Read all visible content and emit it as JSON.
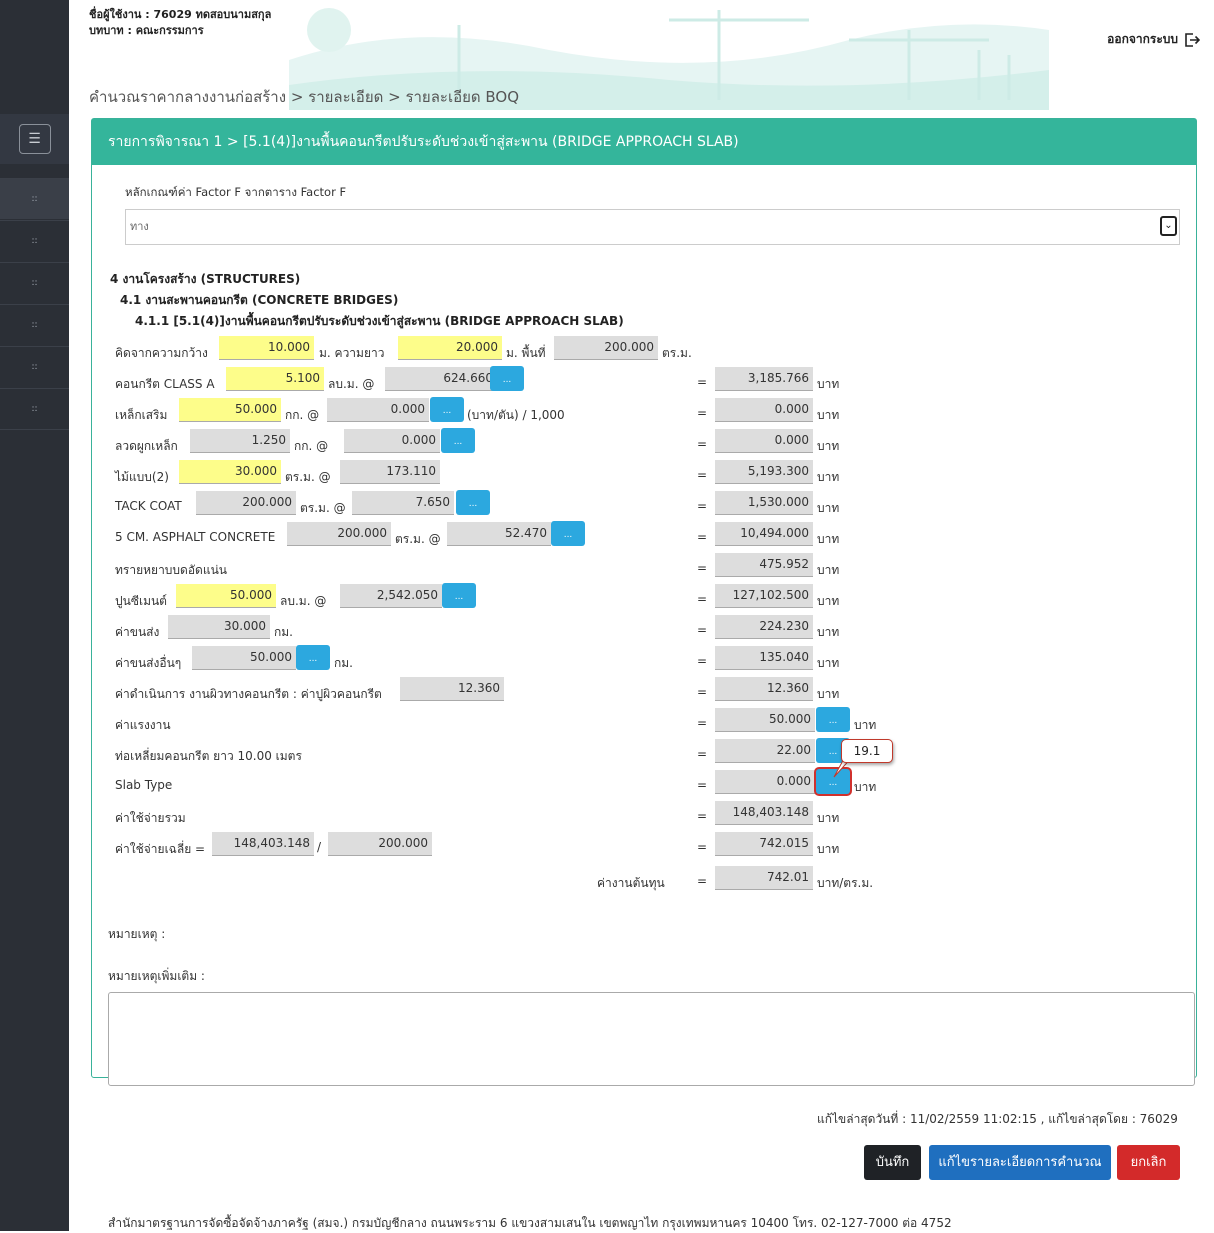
{
  "sidebar": {
    "menu_icon": "menu-icon",
    "items": [
      "::",
      "::",
      "::",
      "::",
      "::",
      "::"
    ]
  },
  "header": {
    "user_line": "ชื่อผู้ใช้งาน : 76029 ทดสอบนามสกุล",
    "role_line": "บทบาท : คณะกรรมการ",
    "logout": "ออกจากระบบ",
    "breadcrumb": "คำนวณราคากลางงานก่อสร้าง > รายละเอียด > รายละเอียด BOQ"
  },
  "panel": {
    "title": "รายการพิจารณา 1 > [5.1(4)]งานพื้นคอนกรีตปรับระดับช่วงเข้าสู่สะพาน (BRIDGE APPROACH SLAB)",
    "factor_label": "หลักเกณฑ์ค่า Factor F จากตาราง Factor F",
    "factor_value": "ทาง",
    "h1": "4 งานโครงสร้าง (STRUCTURES)",
    "h2": "4.1 งานสะพานคอนกรีต (CONCRETE BRIDGES)",
    "h3": "4.1.1 [5.1(4)]งานพื้นคอนกรีตปรับระดับช่วงเข้าสู่สะพาน (BRIDGE APPROACH SLAB)"
  },
  "rows": {
    "dim": {
      "label": "คิดจากความกว้าง",
      "width": "10.000",
      "u1": "ม. ความยาว",
      "length": "20.000",
      "u2": "ม. พื้นที่",
      "area": "200.000",
      "u3": "ตร.ม."
    },
    "concrete": {
      "label": "คอนกรีต CLASS A",
      "qty": "5.100",
      "unit": "ลบ.ม. @",
      "price": "624.660",
      "total": "3,185.766"
    },
    "steel": {
      "label": "เหล็กเสริม",
      "qty": "50.000",
      "unit": "กก. @",
      "price": "0.000",
      "note": "(บาท/ตัน) / 1,000",
      "total": "0.000"
    },
    "wire": {
      "label": "ลวดผูกเหล็ก",
      "qty": "1.250",
      "unit": "กก. @",
      "price": "0.000",
      "total": "0.000"
    },
    "form": {
      "label": "ไม้แบบ(2)",
      "qty": "30.000",
      "unit": "ตร.ม. @",
      "price": "173.110",
      "total": "5,193.300"
    },
    "tack": {
      "label": "TACK COAT",
      "qty": "200.000",
      "unit": "ตร.ม. @",
      "price": "7.650",
      "total": "1,530.000"
    },
    "asphalt": {
      "label": "5 CM. ASPHALT CONCRETE",
      "qty": "200.000",
      "unit": "ตร.ม. @",
      "price": "52.470",
      "total": "10,494.000"
    },
    "sand": {
      "label": "ทรายหยาบบดอัดแน่น",
      "total": "475.952"
    },
    "cement": {
      "label": "ปูนซีเมนต์",
      "qty": "50.000",
      "unit": "ลบ.ม. @",
      "price": "2,542.050",
      "total": "127,102.500"
    },
    "transport": {
      "label": "ค่าขนส่ง",
      "qty": "30.000",
      "unit": "กม.",
      "total": "224.230"
    },
    "transport2": {
      "label": "ค่าขนส่งอื่นๆ",
      "qty": "50.000",
      "unit": "กม.",
      "total": "135.040"
    },
    "operation": {
      "label": "ค่าดำเนินการ งานผิวทางคอนกรีต : ค่าปูผิวคอนกรีต",
      "value": "12.360",
      "total": "12.360"
    },
    "labor": {
      "label": "ค่าแรงงาน",
      "total": "50.000"
    },
    "culvert": {
      "label": "ท่อเหลี่ยมคอนกรีต ยาว 10.00 เมตร",
      "total": "22.00"
    },
    "slab": {
      "label": "Slab Type",
      "total": "0.000"
    },
    "sum": {
      "label": "ค่าใช้จ่ายรวม",
      "total": "148,403.148"
    },
    "avg": {
      "label": "ค่าใช้จ่ายเฉลี่ย =",
      "a": "148,403.148",
      "sep": "/",
      "b": "200.000",
      "total": "742.015"
    },
    "cost": {
      "label": "ค่างานต้นทุน",
      "total": "742.01",
      "unit": "บาท/ตร.ม."
    }
  },
  "common": {
    "eq": "=",
    "baht": "บาท",
    "btn": "..."
  },
  "tooltip": "19.1",
  "remark_label": "หมายเหตุ :",
  "remark_more_label": "หมายเหตุเพิ่มเติม :",
  "last_edit": "แก้ไขล่าสุดวันที่ : 11/02/2559 11:02:15 , แก้ไขล่าสุดโดย : 76029",
  "actions": {
    "save": "บันทึก",
    "edit": "แก้ไขรายละเอียดการคำนวณ",
    "cancel": "ยกเลิก"
  },
  "footer": "สำนักมาตรฐานการจัดซื้อจัดจ้างภาครัฐ (สมจ.) กรมบัญชีกลาง ถนนพระราม 6 แขวงสามเสนใน เขตพญาไท กรุงเทพมหานคร 10400 โทร. 02-127-7000 ต่อ 4752"
}
